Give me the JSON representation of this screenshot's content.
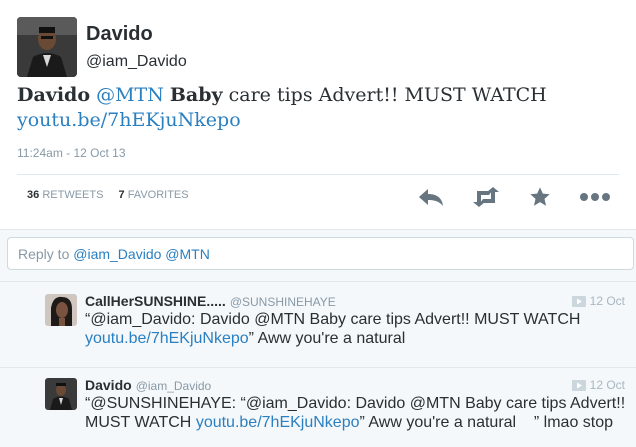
{
  "tweet": {
    "display_name": "Davido",
    "handle": "@iam_Davido",
    "text_part1": "Davido",
    "text_mention": "@MTN",
    "text_bold": "Baby",
    "text_rest": "care tips Advert!! MUST WATCH",
    "link": "youtu.be/7hEKjuNkepo",
    "timestamp": "11:24am - 12 Oct 13",
    "retweets_count": "36",
    "retweets_label": "RETWEETS",
    "favorites_count": "7",
    "favorites_label": "FAVORITES"
  },
  "actions": {
    "reply_icon": "reply-arrow-icon",
    "retweet_icon": "retweet-icon",
    "favorite_icon": "star-icon",
    "more_icon": "ellipsis-icon"
  },
  "reply_box": {
    "prefix": "Reply to ",
    "mentions": "@iam_Davido @MTN"
  },
  "replies": [
    {
      "name": "CallHerSUNSHINE.....",
      "handle": "@SUNSHINEHAYE",
      "time": "12 Oct",
      "text_before": "“@iam_Davido: Davido @MTN Baby care tips Advert!! MUST WATCH",
      "link": "youtu.be/7hEKjuNkepo",
      "text_after": "” Aww you're a natural"
    },
    {
      "name": "Davido",
      "handle": "@iam_Davido",
      "time": "12 Oct",
      "text_before": "“@SUNSHINEHAYE: “@iam_Davido: Davido @MTN Baby care tips Advert!! MUST WATCH",
      "link": "youtu.be/7hEKjuNkepo",
      "text_after": "” Aww you're a natural    ” lmao stop"
    }
  ],
  "colors": {
    "link": "#2a7fc1",
    "muted": "#8899a6",
    "text": "#292f33",
    "icon": "#66757f",
    "reply_bg": "#f5f8fa"
  }
}
